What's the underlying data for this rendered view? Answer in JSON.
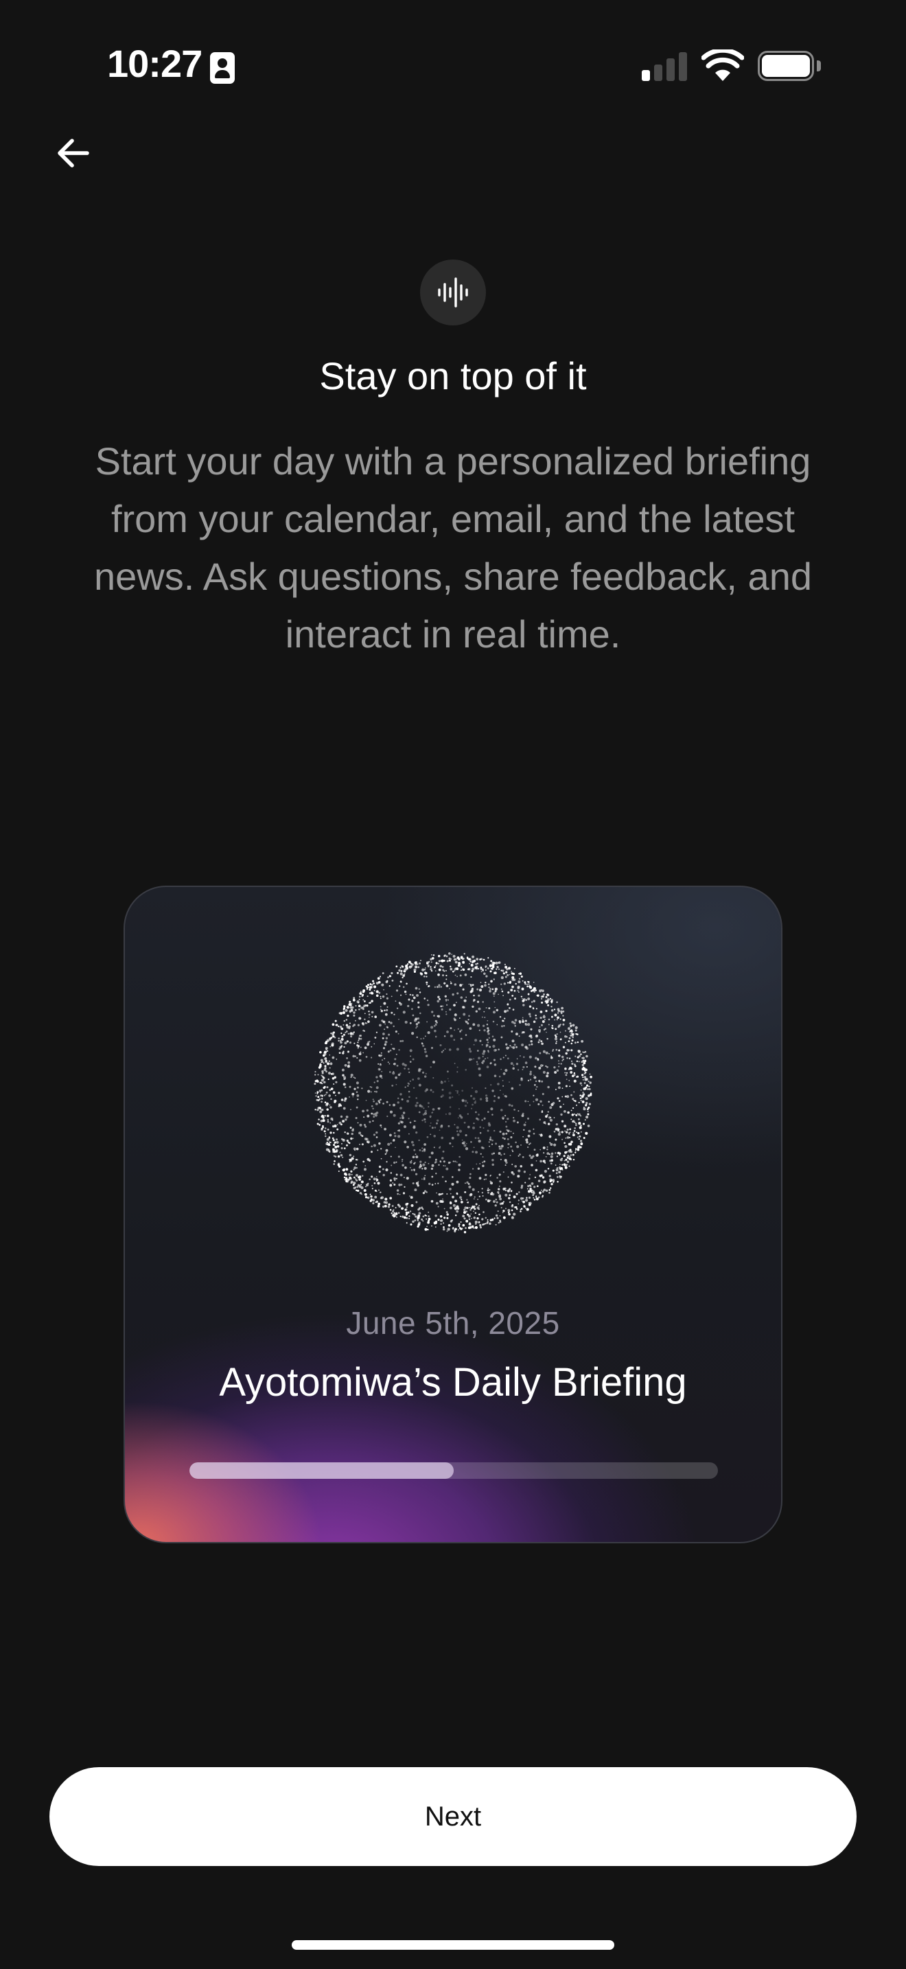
{
  "status_bar": {
    "time": "10:27",
    "icons": [
      "contact-card-icon",
      "cellular-signal-icon",
      "wifi-icon",
      "battery-icon"
    ],
    "signal_bars_active": 1,
    "signal_bars_total": 4,
    "battery_level": 1.0
  },
  "navigation": {
    "back_icon": "arrow-left-icon"
  },
  "header": {
    "icon": "audio-waveform-icon",
    "title": "Stay on top of it",
    "description": "Start your day with a personalized briefing from your calendar, email, and the latest news. Ask questions, share feedback, and interact in real time."
  },
  "briefing_card": {
    "visual": "particle-sphere",
    "date": "June 5th, 2025",
    "title": "Ayotomiwa’s Daily Briefing",
    "progress": 0.5
  },
  "actions": {
    "next_label": "Next"
  },
  "colors": {
    "background": "#131313",
    "text_primary": "#ffffff",
    "text_secondary": "#9a9a9a",
    "button_background": "#ffffff",
    "button_text": "#111111",
    "gradient_coral": "#ec6e5f",
    "gradient_purple": "#a03cbe"
  }
}
